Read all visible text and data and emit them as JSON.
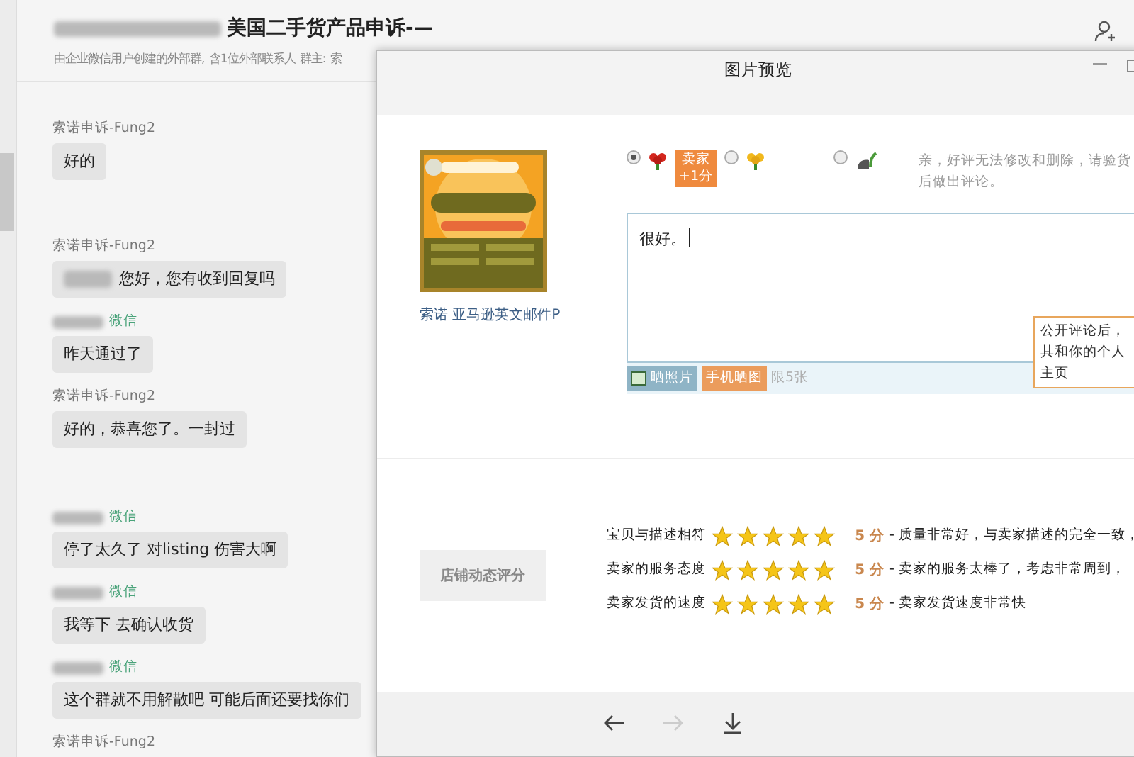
{
  "chat": {
    "title": "美国二手货产品申诉-—",
    "title_blurred": true,
    "subtitle": "由企业微信用户创建的外部群, 含1位外部联系人 群主: 索",
    "messages": [
      {
        "sender": "索诺申诉-Fung2",
        "sender_blurred": false,
        "text": "好的",
        "blur_prefix": false
      },
      {
        "sender": "索诺申诉-Fung2",
        "sender_blurred": false,
        "text": "您好，您有收到回复吗",
        "blur_prefix": true
      },
      {
        "sender": "微信",
        "sender_blurred": true,
        "text": "昨天通过了",
        "blur_prefix": false
      },
      {
        "sender": "索诺申诉-Fung2",
        "sender_blurred": false,
        "text": "好的，恭喜您了。一封过",
        "blur_prefix": false
      },
      {
        "sender": "微信",
        "sender_blurred": true,
        "text": "停了太久了 对listing 伤害大啊",
        "blur_prefix": false
      },
      {
        "sender": "微信",
        "sender_blurred": true,
        "text": "我等下 去确认收货",
        "blur_prefix": false
      },
      {
        "sender": "微信",
        "sender_blurred": true,
        "text": "这个群就不用解散吧  可能后面还要找你们",
        "blur_prefix": false
      },
      {
        "sender": "索诺申诉-Fung2",
        "sender_blurred": false
      }
    ]
  },
  "preview": {
    "title": "图片预览",
    "product": {
      "kind": "picture",
      "caption": "索诺 亚马逊英文邮件P"
    },
    "choices": [
      {
        "kind": "good",
        "selected": true,
        "badge": "卖家+1分"
      },
      {
        "kind": "neutral",
        "selected": false
      },
      {
        "kind": "bad",
        "selected": false
      }
    ],
    "notice": "亲，好评无法修改和删除，请验货后做出评论。",
    "comment": {
      "value": "很好。"
    },
    "tooltip": "公开评论后，其和你的个人主页",
    "upload_buttons": [
      {
        "label": "晒照片"
      },
      {
        "kind": "phone",
        "label": "手机晒图"
      }
    ],
    "limit": "限5张",
    "shop_button": "店铺动态评分",
    "scores": [
      {
        "label": "宝贝与描述相符",
        "stars": 5,
        "score": "5 分",
        "desc": "- 质量非常好，与卖家描述的完全一致，"
      },
      {
        "label": "卖家的服务态度",
        "stars": 5,
        "score": "5 分",
        "desc": "- 卖家的服务太棒了，考虑非常周到，"
      },
      {
        "label": "卖家发货的速度",
        "stars": 5,
        "score": "5 分",
        "desc": "- 卖家发货速度非常快"
      }
    ],
    "nav": [
      {
        "kind": "back",
        "disabled": false
      },
      {
        "kind": "forward",
        "disabled": true
      },
      {
        "kind": "download",
        "disabled": false
      }
    ]
  }
}
